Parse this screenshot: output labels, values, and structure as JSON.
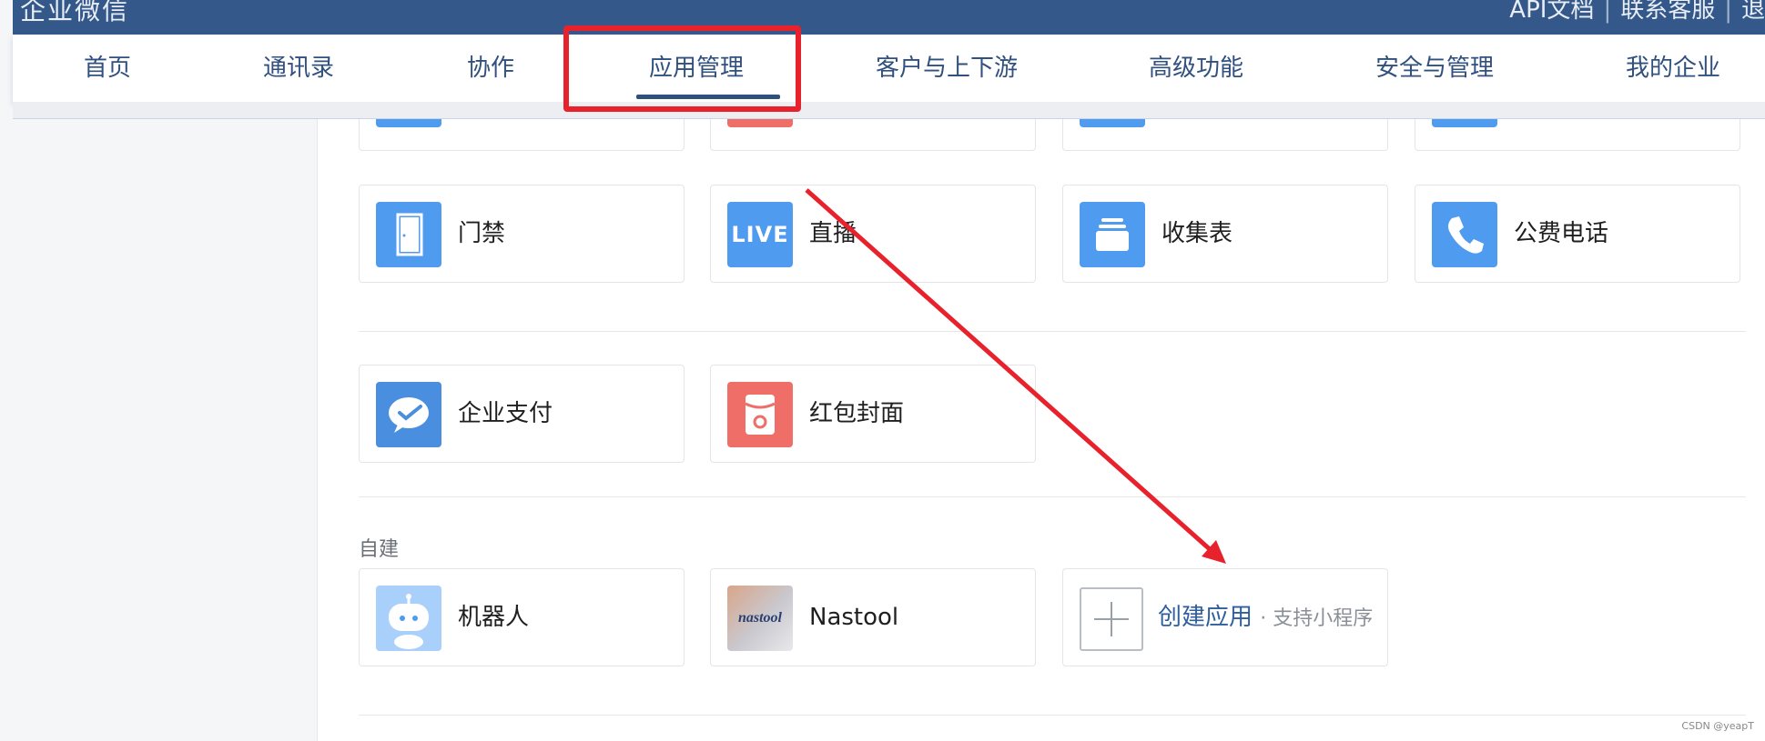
{
  "header": {
    "brand": "企业微信",
    "right_links": [
      "API文档",
      "联系客服",
      "退"
    ]
  },
  "nav": {
    "items": [
      "首页",
      "通讯录",
      "协作",
      "应用管理",
      "客户与上下游",
      "高级功能",
      "安全与管理",
      "我的企业"
    ],
    "active": "应用管理"
  },
  "apps": {
    "row1": [
      {
        "label": "门禁",
        "icon": "door-icon",
        "color": "#4f9bf0"
      },
      {
        "label": "直播",
        "icon": "live-icon",
        "color": "#4f9bf0",
        "badge": "LIVE"
      },
      {
        "label": "收集表",
        "icon": "form-icon",
        "color": "#4f9bf0"
      },
      {
        "label": "公费电话",
        "icon": "phone-icon",
        "color": "#4f9bf0"
      }
    ],
    "row2": [
      {
        "label": "企业支付",
        "icon": "wechat-pay-icon",
        "color": "#4a8ee0"
      },
      {
        "label": "红包封面",
        "icon": "red-packet-icon",
        "color": "#ef6e68"
      }
    ]
  },
  "custom": {
    "section_title": "自建",
    "apps": [
      {
        "label": "机器人",
        "icon": "robot-icon",
        "color": "#a9d0fb"
      },
      {
        "label": "Nastool",
        "icon": "nastool-logo-icon",
        "logo_text": "nastool"
      }
    ],
    "create": {
      "label": "创建应用",
      "sub": "· 支持小程序"
    }
  },
  "watermark": "CSDN @yeapT"
}
